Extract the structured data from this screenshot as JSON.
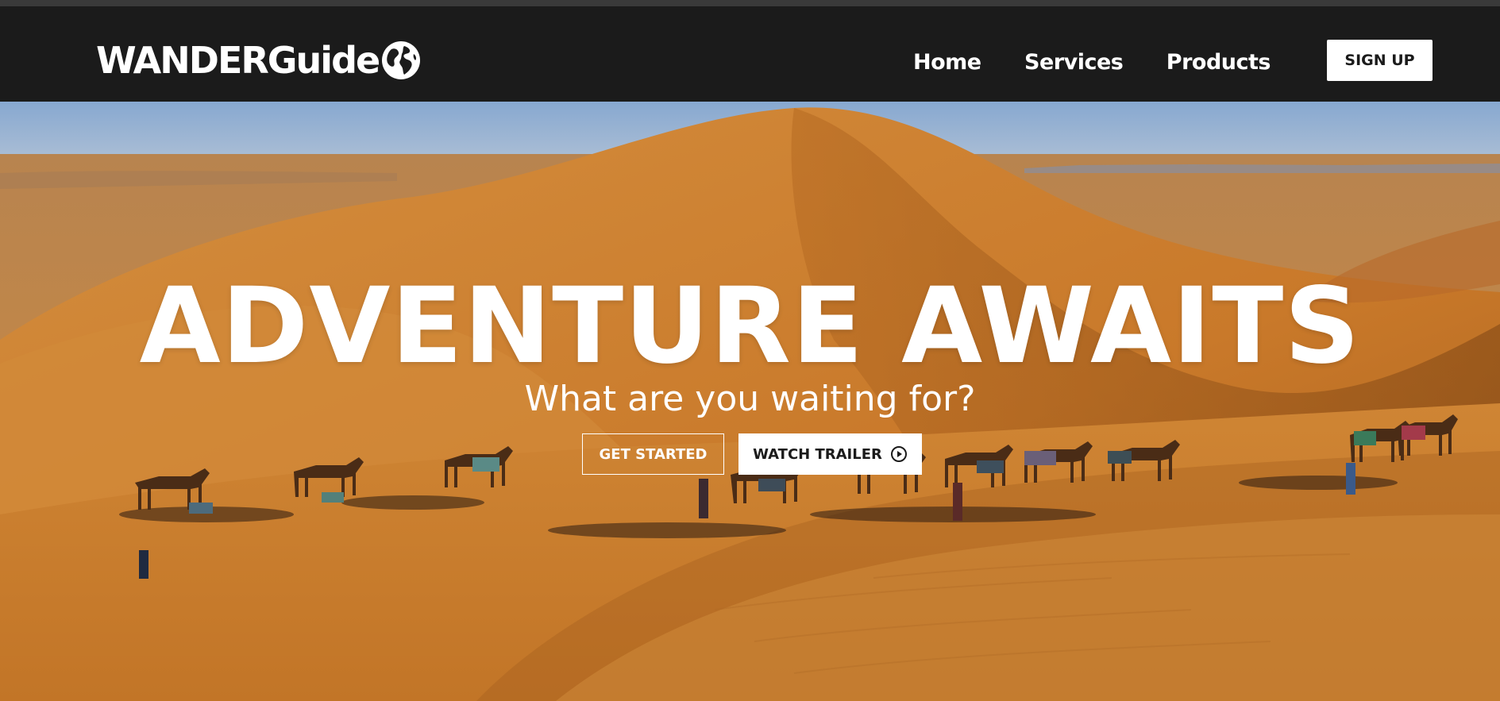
{
  "brand": {
    "name": "WANDERGuide",
    "globe_icon": "globe-icon"
  },
  "nav": {
    "items": [
      {
        "label": "Home"
      },
      {
        "label": "Services"
      },
      {
        "label": "Products"
      }
    ],
    "signup_label": "SIGN UP"
  },
  "hero": {
    "title": "ADVENTURE AWAITS",
    "subtitle": "What are you waiting for?",
    "primary_cta": "GET STARTED",
    "secondary_cta": "WATCH TRAILER",
    "secondary_cta_icon": "play-circle-icon",
    "background": "desert-dunes-camel-caravan-photo"
  },
  "colors": {
    "navbar_bg": "#1b1b1b",
    "sand": "#c97a2a",
    "sky": "#8fb0d6",
    "text_on_dark": "#ffffff"
  }
}
